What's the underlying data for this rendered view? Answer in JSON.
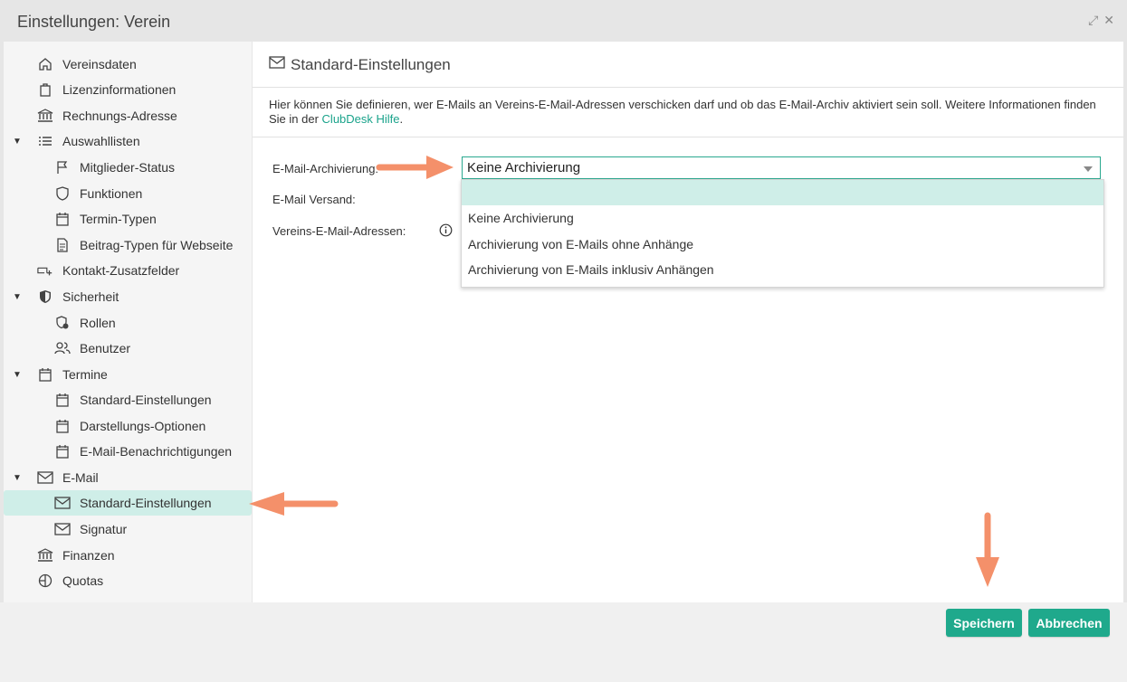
{
  "window": {
    "title": "Einstellungen: Verein"
  },
  "sidebar": {
    "items": [
      {
        "label": "Vereinsdaten",
        "icon": "home-icon"
      },
      {
        "label": "Lizenzinformationen",
        "icon": "bag-icon"
      },
      {
        "label": "Rechnungs-Adresse",
        "icon": "bank-icon"
      },
      {
        "label": "Auswahllisten",
        "icon": "list-icon"
      },
      {
        "label": "Mitglieder-Status",
        "icon": "flag-icon"
      },
      {
        "label": "Funktionen",
        "icon": "shield-icon"
      },
      {
        "label": "Termin-Typen",
        "icon": "calendar-icon"
      },
      {
        "label": "Beitrag-Typen für Webseite",
        "icon": "document-icon"
      },
      {
        "label": "Kontakt-Zusatzfelder",
        "icon": "add-field-icon"
      },
      {
        "label": "Sicherheit",
        "icon": "security-shield-icon"
      },
      {
        "label": "Rollen",
        "icon": "role-shield-icon"
      },
      {
        "label": "Benutzer",
        "icon": "users-icon"
      },
      {
        "label": "Termine",
        "icon": "calendar-icon"
      },
      {
        "label": "Standard-Einstellungen",
        "icon": "calendar-icon"
      },
      {
        "label": "Darstellungs-Optionen",
        "icon": "calendar-icon"
      },
      {
        "label": "E-Mail-Benachrichtigungen",
        "icon": "calendar-icon"
      },
      {
        "label": "E-Mail",
        "icon": "mail-icon"
      },
      {
        "label": "Standard-Einstellungen",
        "icon": "mail-icon"
      },
      {
        "label": "Signatur",
        "icon": "mail-icon"
      },
      {
        "label": "Finanzen",
        "icon": "bank-icon"
      },
      {
        "label": "Quotas",
        "icon": "pie-icon"
      }
    ]
  },
  "content": {
    "title": "Standard-Einstellungen",
    "intro_text": "Hier können Sie definieren, wer E-Mails an Vereins-E-Mail-Adressen verschicken darf und ob das E-Mail-Archiv aktiviert sein soll. Weitere Informationen finden Sie in der ",
    "intro_link": "ClubDesk Hilfe",
    "intro_end": ".",
    "form": {
      "archiving_label": "E-Mail-Archivierung:",
      "sending_label": "E-Mail Versand:",
      "addresses_label": "Vereins-E-Mail-Adressen:",
      "archiving_value": "Keine Archivierung",
      "options": [
        "",
        "Keine Archivierung",
        "Archivierung von E-Mails ohne Anhänge",
        "Archivierung von E-Mails inklusiv Anhängen"
      ]
    }
  },
  "footer": {
    "save": "Speichern",
    "cancel": "Abbrechen"
  },
  "colors": {
    "accent": "#1fa98c",
    "highlight": "#cfeee8",
    "annotation": "#f4906a"
  }
}
